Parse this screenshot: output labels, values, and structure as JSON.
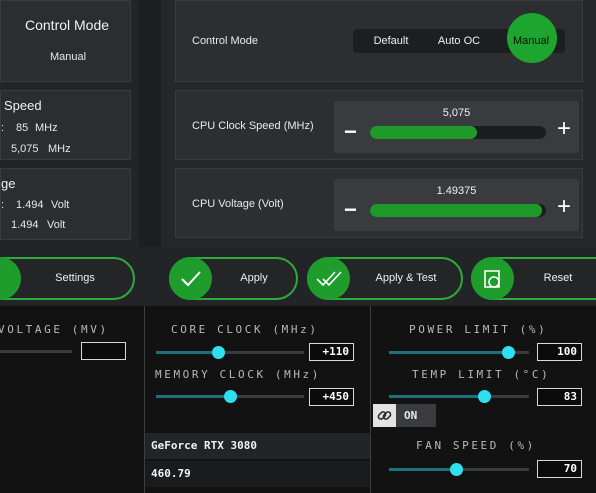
{
  "left_panels": {
    "control_mode_title": "Control Mode",
    "control_mode_value": "Manual",
    "speed_title": "Speed",
    "speed_row1_prefix": ":",
    "speed_row1_value": "85",
    "speed_row1_unit": "MHz",
    "speed_row2_value": "5,075",
    "speed_row2_unit": "MHz",
    "voltage_title": "ge",
    "voltage_row1_prefix": ":",
    "voltage_row1_value": "1.494",
    "voltage_row1_unit": "Volt",
    "voltage_row2_value": "1.494",
    "voltage_row2_unit": "Volt"
  },
  "control_mode": {
    "label": "Control Mode",
    "options": [
      "Default",
      "Auto OC",
      "Manual"
    ],
    "selected": "Manual"
  },
  "cpu_clock": {
    "label": "CPU Clock Speed (MHz)",
    "value": "5,075",
    "fill_fraction": 0.61,
    "minus": "−",
    "plus": "+"
  },
  "cpu_voltage": {
    "label": "CPU Voltage (Volt)",
    "value": "1.49375",
    "fill_fraction": 0.98,
    "minus": "−",
    "plus": "+"
  },
  "actions": {
    "settings_label": "Settings",
    "apply_label": "Apply",
    "apply_test_label": "Apply & Test",
    "reset_label": "Reset"
  },
  "gpu_tool": {
    "voltage_label": "VOLTAGE  (MV)",
    "voltage_value": "",
    "core_clock_label": "CORE CLOCK (MHz)",
    "core_clock_value": "+110",
    "core_clock_fraction": 0.42,
    "memory_clock_label": "MEMORY CLOCK (MHz)",
    "memory_clock_value": "+450",
    "memory_clock_fraction": 0.5,
    "power_limit_label": "POWER LIMIT (%)",
    "power_limit_value": "100",
    "power_limit_fraction": 0.85,
    "temp_limit_label": "TEMP LIMIT (°C)",
    "temp_limit_value": "83",
    "temp_limit_fraction": 0.68,
    "link_toggle_label": "ON",
    "gpu_name": "GeForce RTX 3080",
    "driver_version": "460.79",
    "fan_speed_label": "FAN SPEED (%)",
    "fan_speed_value": "70",
    "fan_speed_fraction": 0.48
  },
  "colors": {
    "accent_green": "#1e9c2c",
    "slider_cyan": "#2ee0ef"
  }
}
